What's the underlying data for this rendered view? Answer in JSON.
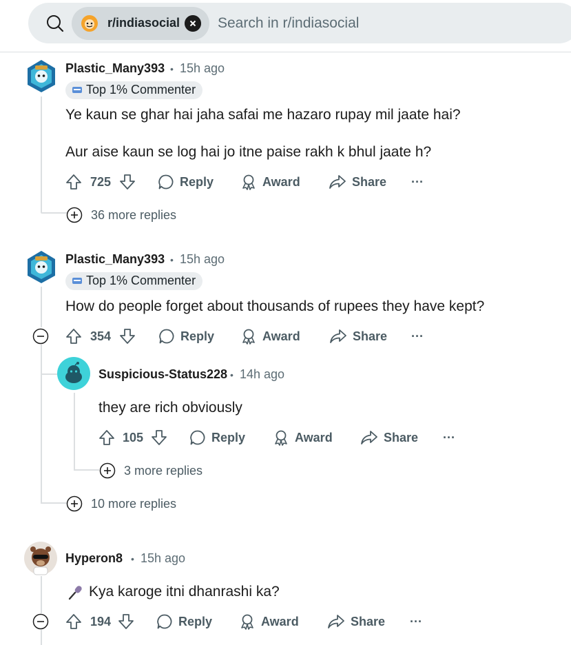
{
  "header": {
    "community": "r/indiasocial",
    "placeholder": "Search in r/indiasocial"
  },
  "actions": {
    "reply": "Reply",
    "award": "Award",
    "share": "Share",
    "more": "···"
  },
  "comments": [
    {
      "user": "Plastic_Many393",
      "time": "15h ago",
      "flair": "Top 1% Commenter",
      "lines": [
        "Ye kaun se ghar hai jaha safai me hazaro rupay mil jaate hai?",
        "Aur aise kaun se log hai jo itne paise rakh k bhul jaate h?"
      ],
      "votes": "725",
      "more_replies": "36 more replies"
    },
    {
      "user": "Plastic_Many393",
      "time": "15h ago",
      "flair": "Top 1% Commenter",
      "lines": [
        "How do people forget about thousands of rupees they have kept?"
      ],
      "votes": "354",
      "more_replies": "10 more replies",
      "reply": {
        "user": "Suspicious-Status228",
        "time": "14h ago",
        "text": "they are rich obviously",
        "votes": "105",
        "more_replies": "3 more replies"
      }
    },
    {
      "user": "Hyperon8",
      "time": "15h ago",
      "text": "Kya karoge itni dhanrashi ka?",
      "votes": "194"
    }
  ]
}
